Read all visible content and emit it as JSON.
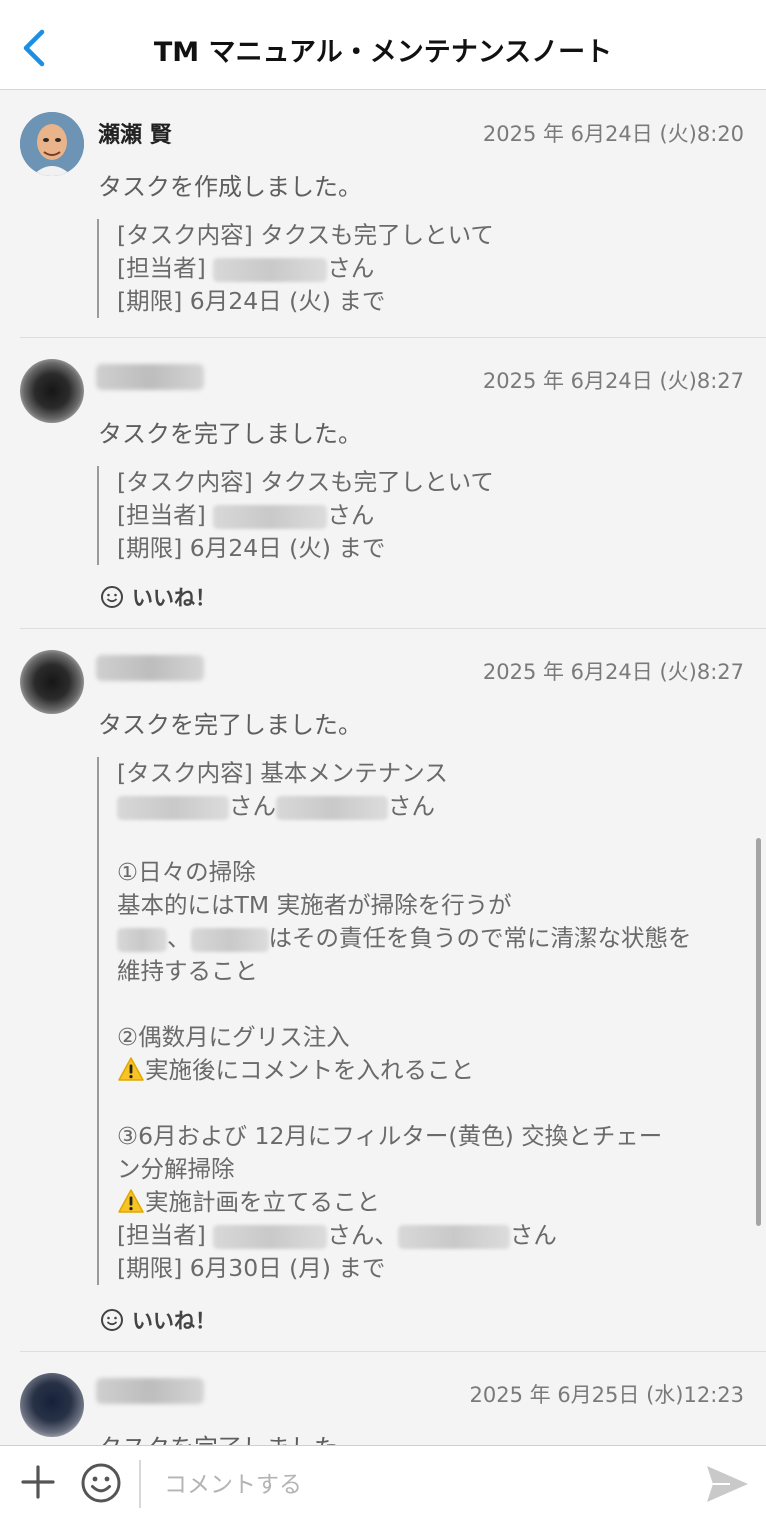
{
  "header": {
    "title": "TM マニュアル・メンテナンスノート",
    "back_icon": "chevron-left-icon",
    "accent": "#1a8fe3"
  },
  "messages": [
    {
      "author": "瀬瀬 賢",
      "time": "2025 年 6月24日 (火)8:20",
      "action": "タスクを作成しました。",
      "quote": {
        "line1": "[タスク内容] タクスも完了しといて",
        "assignee_label": "[担当者]",
        "san": "さん",
        "deadline": "[期限] 6月24日 (火) まで"
      }
    },
    {
      "time": "2025 年 6月24日 (火)8:27",
      "action": "タスクを完了しました。",
      "quote": {
        "line1": "[タスク内容] タクスも完了しといて",
        "assignee_label": "[担当者]",
        "san": "さん",
        "deadline": "[期限] 6月24日 (火) まで"
      },
      "like": "いいね！"
    },
    {
      "time": "2025 年 6月24日 (火)8:27",
      "action": "タスクを完了しました。",
      "quote": {
        "line1": "[タスク内容] 基本メンテナンス",
        "san": "さん",
        "item1_title": "①日々の掃除",
        "item1_l1": "基本的にはTM 実施者が掃除を行うが",
        "item1_comma": "、",
        "item1_l2": "はその責任を負うので常に清潔な状態を",
        "item1_l3": "維持すること",
        "item2_title": "②偶数月にグリス注入",
        "item2_warn": "実施後にコメントを入れること",
        "item3_l1": "③6月および 12月にフィルター(黄色) 交換とチェー",
        "item3_l2": "ン分解掃除",
        "item3_warn": "実施計画を立てること",
        "assignee_label": "[担当者]",
        "san_comma": "さん、",
        "deadline": "[期限] 6月30日 (月) まで"
      },
      "like": "いいね！"
    },
    {
      "time": "2025 年 6月25日 (水)12:23",
      "action": "タスクを完了しました。"
    }
  ],
  "composer": {
    "placeholder": "コメントする",
    "plus_icon": "plus-icon",
    "emoji_icon": "smiley-icon",
    "send_icon": "send-icon"
  }
}
